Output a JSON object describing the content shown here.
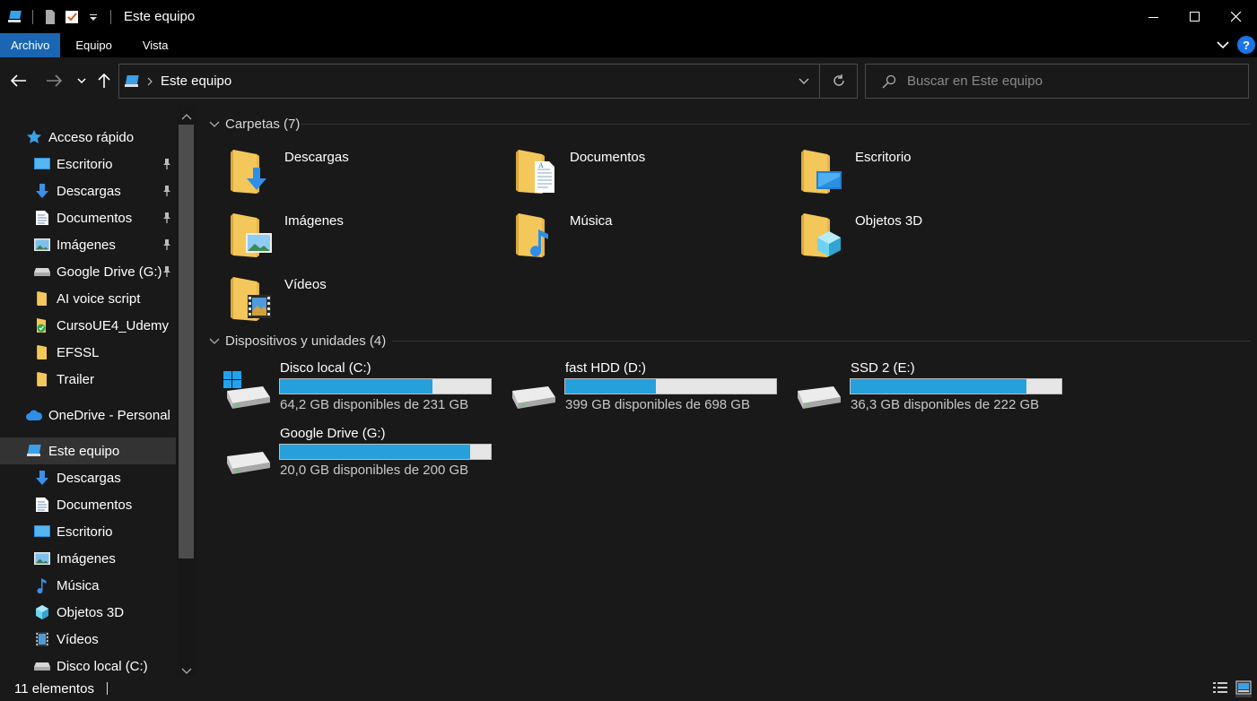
{
  "window": {
    "title": "Este equipo",
    "minimize": "—",
    "maximize": "☐",
    "close": "✕"
  },
  "ribbon": {
    "tabs": [
      "Archivo",
      "Equipo",
      "Vista"
    ],
    "help": "?"
  },
  "address": {
    "location": "Este equipo",
    "search_placeholder": "Buscar en Este equipo"
  },
  "sidebar": {
    "items": [
      {
        "label": "Acceso rápido",
        "icon": "star-icon",
        "pinned": false
      },
      {
        "label": "Escritorio",
        "icon": "desktop-icon",
        "pinned": true
      },
      {
        "label": "Descargas",
        "icon": "download-arrow-icon",
        "pinned": true
      },
      {
        "label": "Documentos",
        "icon": "document-icon",
        "pinned": true
      },
      {
        "label": "Imágenes",
        "icon": "image-icon",
        "pinned": true
      },
      {
        "label": "Google Drive (G:)",
        "icon": "drive-icon",
        "pinned": true
      },
      {
        "label": "AI voice script",
        "icon": "folder-icon",
        "pinned": false
      },
      {
        "label": "CursoUE4_Udemy",
        "icon": "synced-folder-icon",
        "pinned": false
      },
      {
        "label": "EFSSL",
        "icon": "folder-icon",
        "pinned": false
      },
      {
        "label": "Trailer",
        "icon": "folder-icon",
        "pinned": false
      },
      {
        "label": "OneDrive - Personal",
        "icon": "cloud-icon",
        "pinned": false
      },
      {
        "label": "Este equipo",
        "icon": "computer-icon",
        "pinned": false
      },
      {
        "label": "Descargas",
        "icon": "download-arrow-icon",
        "pinned": false
      },
      {
        "label": "Documentos",
        "icon": "document-icon",
        "pinned": false
      },
      {
        "label": "Escritorio",
        "icon": "desktop-icon",
        "pinned": false
      },
      {
        "label": "Imágenes",
        "icon": "image-icon",
        "pinned": false
      },
      {
        "label": "Música",
        "icon": "music-note-icon",
        "pinned": false
      },
      {
        "label": "Objetos 3D",
        "icon": "cube-icon",
        "pinned": false
      },
      {
        "label": "Vídeos",
        "icon": "film-icon",
        "pinned": false
      },
      {
        "label": "Disco local (C:)",
        "icon": "drive-icon",
        "pinned": false
      }
    ]
  },
  "folders_group": {
    "title": "Carpetas (7)",
    "items": [
      {
        "label": "Descargas",
        "icon": "downloads-folder-icon"
      },
      {
        "label": "Documentos",
        "icon": "documents-folder-icon"
      },
      {
        "label": "Escritorio",
        "icon": "desktop-folder-icon"
      },
      {
        "label": "Imágenes",
        "icon": "pictures-folder-icon"
      },
      {
        "label": "Música",
        "icon": "music-folder-icon"
      },
      {
        "label": "Objetos 3D",
        "icon": "3d-objects-folder-icon"
      },
      {
        "label": "Vídeos",
        "icon": "videos-folder-icon"
      }
    ]
  },
  "drives_group": {
    "title": "Dispositivos y unidades (4)",
    "items": [
      {
        "name": "Disco local (C:)",
        "free": "64,2 GB disponibles de 231 GB",
        "used_fraction": 0.722,
        "windows_logo": true
      },
      {
        "name": "fast HDD (D:)",
        "free": "399 GB disponibles de 698 GB",
        "used_fraction": 0.428,
        "windows_logo": false
      },
      {
        "name": "SSD 2 (E:)",
        "free": "36,3 GB disponibles de 222 GB",
        "used_fraction": 0.836,
        "windows_logo": false
      },
      {
        "name": "Google Drive (G:)",
        "free": "20,0 GB disponibles de 200 GB",
        "used_fraction": 0.9,
        "windows_logo": false
      }
    ]
  },
  "status": {
    "count": "11 elementos"
  },
  "colors": {
    "accent": "#1a66b3",
    "bar_fill": "#26a0da",
    "folder": "#f4c75a"
  }
}
